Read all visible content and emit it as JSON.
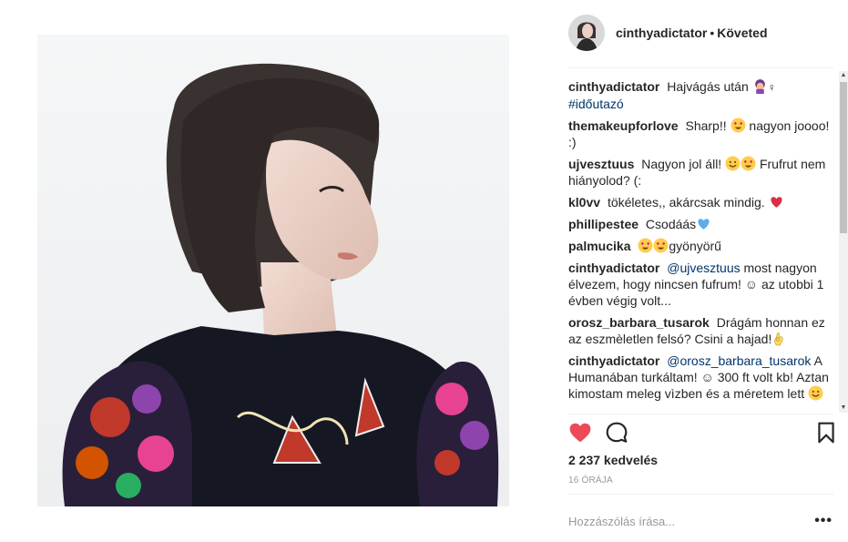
{
  "post": {
    "photo_alt": "",
    "owner": "cinthyadictator",
    "separator": "•",
    "follow_status": "Követed"
  },
  "comments": [
    {
      "user": "cinthyadictator",
      "text": "Hajvágás után",
      "emoji": [
        "woman-haircut-emoji",
        "female-sign"
      ],
      "hashtag": "#időutazó"
    },
    {
      "user": "themakeupforlove",
      "text": "Sharp!!",
      "emoji_after_text": "heart-eyes-emoji",
      "text2": "nagyon joooo! :)"
    },
    {
      "user": "ujvesztuus",
      "text": "Nagyon jol áll!",
      "emoji_after_text": [
        "smile-emoji",
        "heart-eyes-emoji"
      ],
      "text2": "Frufrut nem hiányolod? (:"
    },
    {
      "user": "kl0vv",
      "text": "tökéletes,, akárcsak mindig.",
      "emoji_after_text": "red-heart-emoji"
    },
    {
      "user": "phillipestee",
      "text": "Csodáás",
      "emoji_after_text": "blue-heart-emoji"
    },
    {
      "user": "palmucika",
      "emoji_before_text": [
        "heart-eyes-emoji",
        "heart-eyes-emoji"
      ],
      "text": "gyönyörű"
    },
    {
      "user": "cinthyadictator",
      "mention": "@ujvesztuus",
      "text": "most nagyon élvezem, hogy nincsen fufrum! ☺ az utobbi 1 évben végig volt..."
    },
    {
      "user": "orosz_barbara_tusarok",
      "text": "Drágám honnan ez az eszmèletlen felsó? Csini a hajad!",
      "emoji_after_text": "ok-hand-emoji"
    },
    {
      "user": "cinthyadictator",
      "mention": "@orosz_barbara_tusarok",
      "text": "A Humanában turkáltam! ☺ 300 ft volt kb! Aztan kimostam meleg vìzben és a méretem lett",
      "emoji_after_text": "smile-emoji"
    }
  ],
  "actions": {
    "like_icon": "heart-filled-icon",
    "like_color": "#ed4956",
    "comment_icon": "comment-bubble-icon",
    "save_icon": "bookmark-icon"
  },
  "likes_text": "2 237 kedvelés",
  "time_text": "16 ÓRÁJA",
  "add_comment": {
    "placeholder": "Hozzászólás írása...",
    "more_label": "•••"
  },
  "colors": {
    "text": "#262626",
    "link": "#003569",
    "muted": "#999999",
    "divider": "#efefef"
  }
}
